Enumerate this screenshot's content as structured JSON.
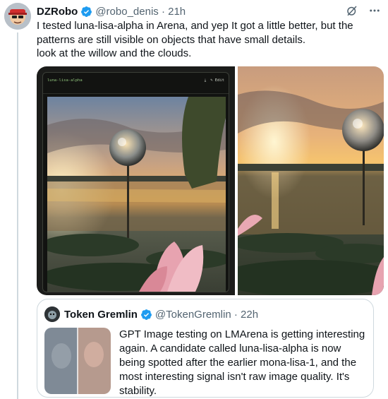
{
  "tweet": {
    "author": {
      "display_name": "DZRobo",
      "handle": "@robo_denis",
      "time": "21h",
      "verified": true
    },
    "text": "I tested luna-lisa-alpha in Arena, and yep It got a little better, but the patterns are still visible on objects that have small details.\nlook at the willow and the clouds.",
    "media": {
      "left_ui_title": "luna-lisa-alpha",
      "left_ui_download_icon": "download-icon",
      "left_ui_edit_label": "Edit"
    },
    "icons": {
      "grok": "grok-icon",
      "more": "more-icon"
    }
  },
  "quote": {
    "author": {
      "display_name": "Token Gremlin",
      "handle": "@TokenGremlin",
      "time": "22h",
      "verified": true
    },
    "text": "GPT Image testing on LMArena is getting interesting again. A candidate called luna-lisa-alpha is now being spotted after the earlier mona-lisa-1, and the most interesting signal isn't raw image quality. It's stability.\n..."
  },
  "colors": {
    "verified": "#1d9bf0",
    "secondary_text": "#536471",
    "border": "#cfd9de"
  }
}
